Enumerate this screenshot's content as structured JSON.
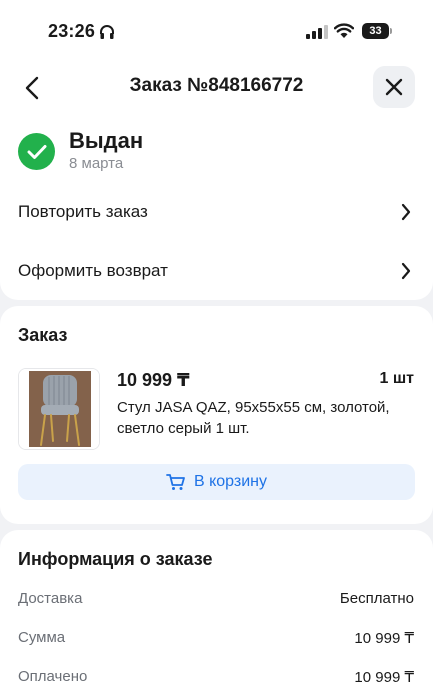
{
  "status_bar": {
    "time": "23:26",
    "battery": "33"
  },
  "header": {
    "title": "Заказ №848166772"
  },
  "order_status": {
    "title": "Выдан",
    "date": "8 марта"
  },
  "actions": [
    {
      "label": "Повторить заказ"
    },
    {
      "label": "Оформить возврат"
    }
  ],
  "order_section": {
    "title": "Заказ",
    "product": {
      "price": "10 999 ₸",
      "quantity": "1 шт",
      "name": "Стул JASA QAZ, 95x55x55 см, золотой, светло серый 1 шт."
    },
    "cart_button_label": "В корзину"
  },
  "info_section": {
    "title": "Информация о заказе",
    "rows": [
      {
        "label": "Доставка",
        "value": "Бесплатно"
      },
      {
        "label": "Сумма",
        "value": "10 999 ₸"
      },
      {
        "label": "Оплачено",
        "value": "10 999 ₸"
      }
    ]
  },
  "colors": {
    "accent": "#1f73e6",
    "success": "#22b14c",
    "background": "#f1f2f5"
  }
}
